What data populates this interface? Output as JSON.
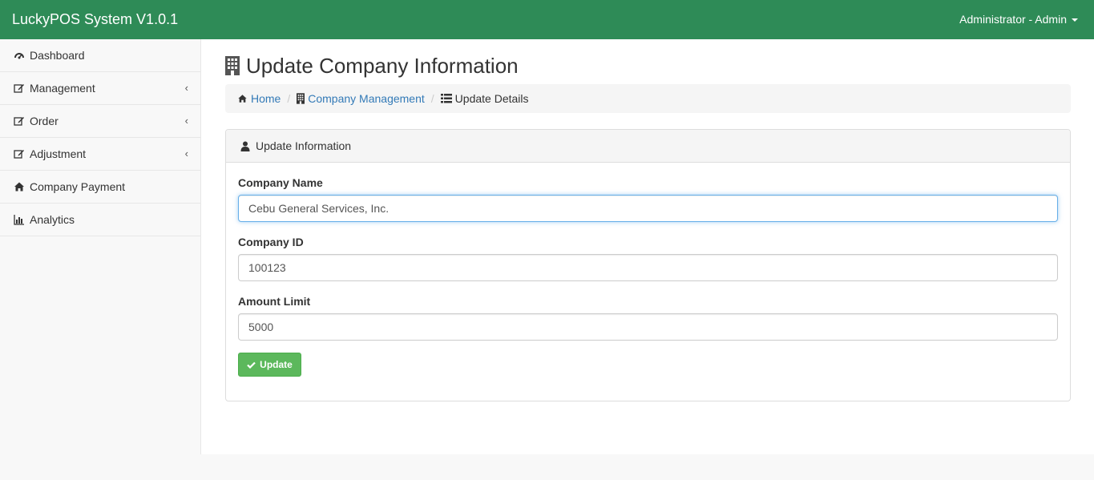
{
  "navbar": {
    "brand": "LuckyPOS System V1.0.1",
    "user_label": "Administrator - Admin"
  },
  "sidebar": {
    "items": [
      {
        "label": "Dashboard",
        "icon": "dashboard-icon"
      },
      {
        "label": "Management",
        "icon": "edit-icon",
        "chevron": "‹"
      },
      {
        "label": "Order",
        "icon": "edit-icon",
        "chevron": "‹"
      },
      {
        "label": "Adjustment",
        "icon": "edit-icon",
        "chevron": "‹"
      },
      {
        "label": "Company Payment",
        "icon": "home-icon"
      },
      {
        "label": "Analytics",
        "icon": "bar-chart-icon"
      }
    ]
  },
  "page": {
    "title": "Update Company Information",
    "title_icon": "building-icon"
  },
  "breadcrumb": {
    "home": "Home",
    "management": "Company Management",
    "separator": "/",
    "current": "Update Details"
  },
  "panel": {
    "heading": "Update Information",
    "heading_icon": "user-icon"
  },
  "form": {
    "company_name_label": "Company Name",
    "company_name_value": "Cebu General Services, Inc.",
    "company_id_label": "Company ID",
    "company_id_value": "100123",
    "amount_limit_label": "Amount Limit",
    "amount_limit_value": "5000",
    "submit_label": "Update"
  },
  "colors": {
    "navbar_bg": "#2e8b57",
    "link": "#337ab7",
    "button_success": "#5cb85c"
  }
}
